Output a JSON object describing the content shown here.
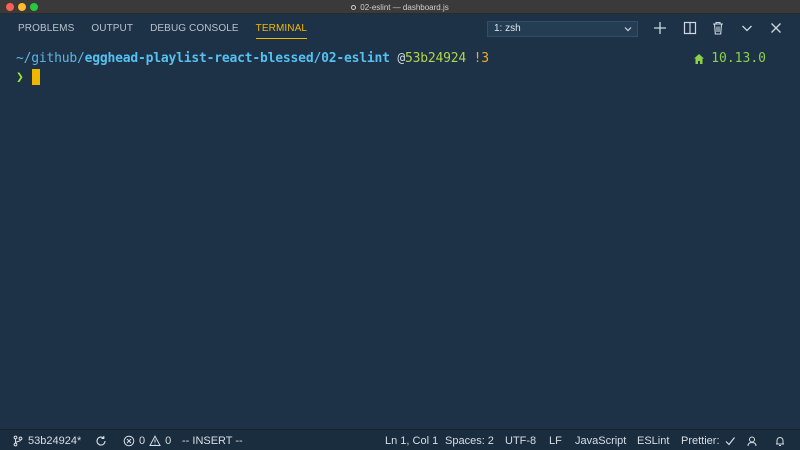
{
  "window": {
    "title": "02-eslint — dashboard.js"
  },
  "panel": {
    "tabs": [
      {
        "label": "PROBLEMS",
        "active": false
      },
      {
        "label": "OUTPUT",
        "active": false
      },
      {
        "label": "DEBUG CONSOLE",
        "active": false
      },
      {
        "label": "TERMINAL",
        "active": true
      }
    ],
    "terminal_select": "1: zsh",
    "icons": [
      "plus-icon",
      "split-icon",
      "trash-icon",
      "chevron-down-icon",
      "close-icon"
    ]
  },
  "terminal": {
    "prompt": {
      "path_prefix": "~/github/",
      "path_repo": "egghead-playlist-react-blessed/02-eslint",
      "at": " @",
      "hash": "53b24924",
      "status": " !3"
    },
    "node_version": "10.13.0",
    "input_prompt": "❯"
  },
  "statusbar": {
    "branch": "53b24924*",
    "errors": "0",
    "warnings": "0",
    "mode": "-- INSERT --",
    "position": "Ln 1, Col 1",
    "spaces": "Spaces: 2",
    "encoding": "UTF-8",
    "eol": "LF",
    "language": "JavaScript",
    "linter": "ESLint",
    "formatter": "Prettier:"
  },
  "colors": {
    "background": "#1d3246",
    "accent": "#f2b600",
    "path": "#55c1f2",
    "hash": "#b1d34e",
    "node": "#8cd04a"
  }
}
